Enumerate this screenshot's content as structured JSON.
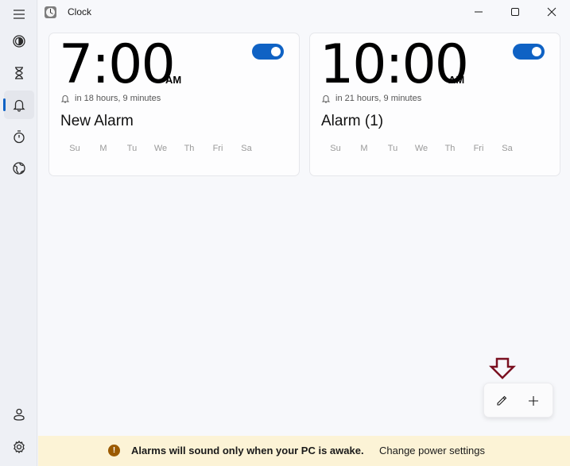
{
  "app": {
    "title": "Clock"
  },
  "window_controls": {
    "minimize": "minimize",
    "maximize": "maximize",
    "close": "close"
  },
  "sidebar": {
    "items": [
      {
        "id": "menu",
        "icon": "hamburger-menu-icon"
      },
      {
        "id": "focus-sessions",
        "icon": "focus-icon"
      },
      {
        "id": "timer",
        "icon": "hourglass-icon"
      },
      {
        "id": "alarm",
        "icon": "bell-icon",
        "active": true
      },
      {
        "id": "stopwatch",
        "icon": "stopwatch-icon"
      },
      {
        "id": "world-clock",
        "icon": "globe-icon"
      },
      {
        "id": "account",
        "icon": "person-icon"
      },
      {
        "id": "settings",
        "icon": "gear-icon"
      }
    ]
  },
  "alarms": [
    {
      "time": "7:00",
      "ampm": "AM",
      "enabled": true,
      "remaining": "in 18 hours, 9 minutes",
      "name": "New Alarm",
      "days": [
        "Su",
        "M",
        "Tu",
        "We",
        "Th",
        "Fri",
        "Sa"
      ]
    },
    {
      "time": "10:00",
      "ampm": "AM",
      "enabled": true,
      "remaining": "in 21 hours, 9 minutes",
      "name": "Alarm (1)",
      "days": [
        "Su",
        "M",
        "Tu",
        "We",
        "Th",
        "Fri",
        "Sa"
      ]
    }
  ],
  "fab": {
    "edit_icon": "pencil-icon",
    "add_icon": "plus-icon"
  },
  "annotation": {
    "color": "#7a1020"
  },
  "banner": {
    "icon": "!",
    "message": "Alarms will sound only when your PC is awake.",
    "link": "Change power settings"
  },
  "colors": {
    "accent": "#0f62c4",
    "banner_bg": "#fcf3d6",
    "warning": "#9b5a00"
  }
}
